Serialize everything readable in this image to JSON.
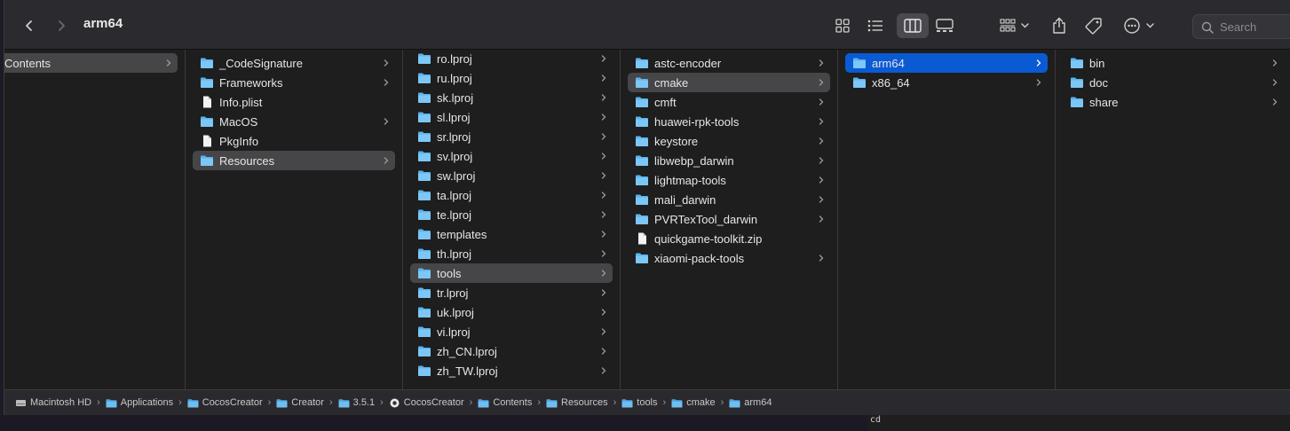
{
  "window": {
    "title": "arm64",
    "search_placeholder": "Search"
  },
  "toolbar": {
    "back_icon": "chevron-left-icon",
    "forward_icon": "chevron-right-icon",
    "view_icons": [
      "icon-view-icon",
      "list-view-icon",
      "column-view-icon",
      "gallery-view-icon"
    ],
    "group_icon": "group-icon",
    "share_icon": "share-icon",
    "tag_icon": "tag-icon",
    "more_icon": "ellipsis-icon"
  },
  "columns": [
    {
      "items": [
        {
          "label": "Contents",
          "type": "folder",
          "state": "selected",
          "chevron": true
        }
      ]
    },
    {
      "items": [
        {
          "label": "_CodeSignature",
          "type": "folder",
          "chevron": true
        },
        {
          "label": "Frameworks",
          "type": "folder",
          "chevron": true
        },
        {
          "label": "Info.plist",
          "type": "file",
          "chevron": false
        },
        {
          "label": "MacOS",
          "type": "folder",
          "chevron": true
        },
        {
          "label": "PkgInfo",
          "type": "file",
          "chevron": false
        },
        {
          "label": "Resources",
          "type": "folder",
          "state": "selected",
          "chevron": true
        }
      ]
    },
    {
      "items": [
        {
          "label": "ro.lproj",
          "type": "folder",
          "chevron": true
        },
        {
          "label": "ru.lproj",
          "type": "folder",
          "chevron": true
        },
        {
          "label": "sk.lproj",
          "type": "folder",
          "chevron": true
        },
        {
          "label": "sl.lproj",
          "type": "folder",
          "chevron": true
        },
        {
          "label": "sr.lproj",
          "type": "folder",
          "chevron": true
        },
        {
          "label": "sv.lproj",
          "type": "folder",
          "chevron": true
        },
        {
          "label": "sw.lproj",
          "type": "folder",
          "chevron": true
        },
        {
          "label": "ta.lproj",
          "type": "folder",
          "chevron": true
        },
        {
          "label": "te.lproj",
          "type": "folder",
          "chevron": true
        },
        {
          "label": "templates",
          "type": "folder",
          "chevron": true
        },
        {
          "label": "th.lproj",
          "type": "folder",
          "chevron": true
        },
        {
          "label": "tools",
          "type": "folder",
          "state": "selected",
          "chevron": true
        },
        {
          "label": "tr.lproj",
          "type": "folder",
          "chevron": true
        },
        {
          "label": "uk.lproj",
          "type": "folder",
          "chevron": true
        },
        {
          "label": "vi.lproj",
          "type": "folder",
          "chevron": true
        },
        {
          "label": "zh_CN.lproj",
          "type": "folder",
          "chevron": true
        },
        {
          "label": "zh_TW.lproj",
          "type": "folder",
          "chevron": true
        }
      ]
    },
    {
      "items": [
        {
          "label": "astc-encoder",
          "type": "folder",
          "chevron": true
        },
        {
          "label": "cmake",
          "type": "folder",
          "state": "selected",
          "chevron": true
        },
        {
          "label": "cmft",
          "type": "folder",
          "chevron": true
        },
        {
          "label": "huawei-rpk-tools",
          "type": "folder",
          "chevron": true
        },
        {
          "label": "keystore",
          "type": "folder",
          "chevron": true
        },
        {
          "label": "libwebp_darwin",
          "type": "folder",
          "chevron": true
        },
        {
          "label": "lightmap-tools",
          "type": "folder",
          "chevron": true
        },
        {
          "label": "mali_darwin",
          "type": "folder",
          "chevron": true
        },
        {
          "label": "PVRTexTool_darwin",
          "type": "folder",
          "chevron": true
        },
        {
          "label": "quickgame-toolkit.zip",
          "type": "file",
          "chevron": false
        },
        {
          "label": "xiaomi-pack-tools",
          "type": "folder",
          "chevron": true
        }
      ]
    },
    {
      "items": [
        {
          "label": "arm64",
          "type": "folder",
          "state": "active",
          "chevron": true
        },
        {
          "label": "x86_64",
          "type": "folder",
          "chevron": true
        }
      ]
    },
    {
      "items": [
        {
          "label": "bin",
          "type": "folder",
          "chevron": true
        },
        {
          "label": "doc",
          "type": "folder",
          "chevron": true
        },
        {
          "label": "share",
          "type": "folder",
          "chevron": true
        }
      ]
    }
  ],
  "pathbar": [
    {
      "label": "Macintosh HD",
      "icon": "disk-icon"
    },
    {
      "label": "Applications",
      "icon": "folder-icon"
    },
    {
      "label": "CocosCreator",
      "icon": "folder-icon"
    },
    {
      "label": "Creator",
      "icon": "folder-icon"
    },
    {
      "label": "3.5.1",
      "icon": "folder-icon"
    },
    {
      "label": "CocosCreator",
      "icon": "app-icon"
    },
    {
      "label": "Contents",
      "icon": "folder-icon"
    },
    {
      "label": "Resources",
      "icon": "folder-icon"
    },
    {
      "label": "tools",
      "icon": "folder-icon"
    },
    {
      "label": "cmake",
      "icon": "folder-icon"
    },
    {
      "label": "arm64",
      "icon": "folder-icon"
    }
  ],
  "terminal": {
    "line": "cd"
  },
  "colors": {
    "folder": "#5ab4ee",
    "selection_active": "#0a5bd3",
    "selection_inactive": "#464649"
  }
}
